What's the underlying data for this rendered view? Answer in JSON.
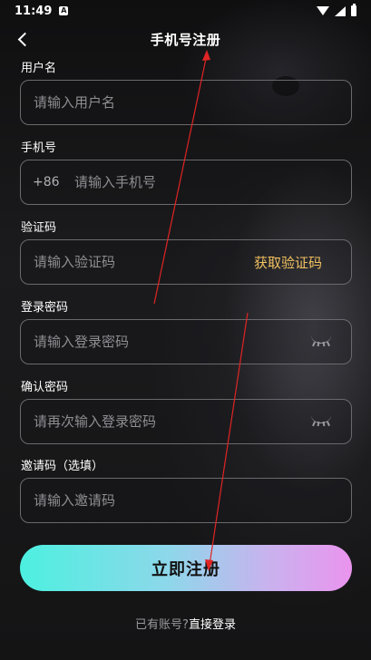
{
  "status_bar": {
    "time": "11:49",
    "notification_glyph": "A"
  },
  "header": {
    "title": "手机号注册"
  },
  "form": {
    "username": {
      "label": "用户名",
      "placeholder": "请输入用户名"
    },
    "phone": {
      "label": "手机号",
      "prefix": "+86",
      "placeholder": "请输入手机号"
    },
    "code": {
      "label": "验证码",
      "placeholder": "请输入验证码",
      "action": "获取验证码"
    },
    "password": {
      "label": "登录密码",
      "placeholder": "请输入登录密码"
    },
    "confirm": {
      "label": "确认密码",
      "placeholder": "请再次输入登录密码"
    },
    "invite": {
      "label": "邀请码（选填）",
      "placeholder": "请输入邀请码"
    }
  },
  "submit_label": "立即注册",
  "footer": {
    "prompt": "已有账号?",
    "link": "直接登录"
  },
  "colors": {
    "accent": "#f2c060",
    "annotation": "#e02424"
  },
  "icons": [
    "back-icon",
    "eye-closed-icon",
    "wifi-icon",
    "signal-icon",
    "battery-icon"
  ]
}
